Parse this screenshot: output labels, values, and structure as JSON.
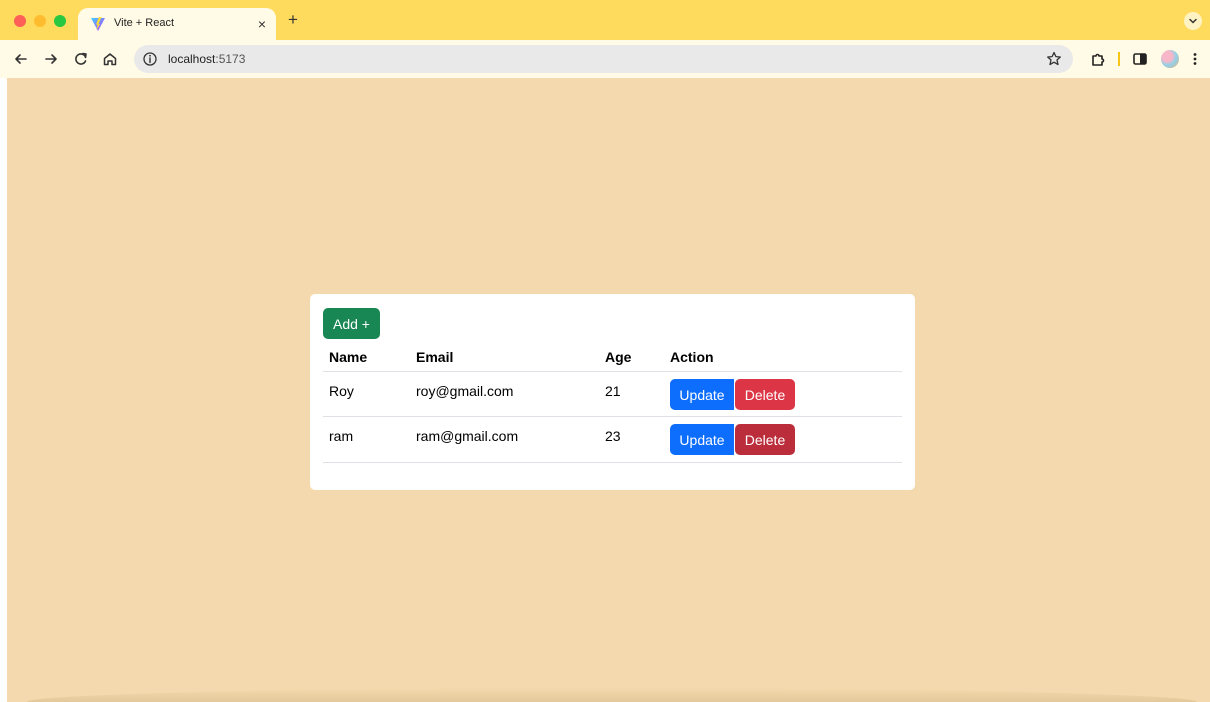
{
  "browser": {
    "tab_title": "Vite + React",
    "tab_close": "×",
    "new_tab": "+",
    "url_host": "localhost",
    "url_port": ":5173"
  },
  "page": {
    "add_label": "Add +",
    "columns": {
      "name": "Name",
      "email": "Email",
      "age": "Age",
      "action": "Action"
    },
    "users": [
      {
        "name": "Roy",
        "email": "roy@gmail.com",
        "age": "21"
      },
      {
        "name": "ram",
        "email": "ram@gmail.com",
        "age": "23"
      }
    ],
    "update_label": "Update",
    "delete_label": "Delete"
  },
  "colors": {
    "tab_strip": "#fedb5d",
    "page_background": "#f3d9ad",
    "add_button": "#198754",
    "update_button": "#0d6efd",
    "delete_button": "#dc3545",
    "delete_button_hover": "#bb2d3b"
  }
}
